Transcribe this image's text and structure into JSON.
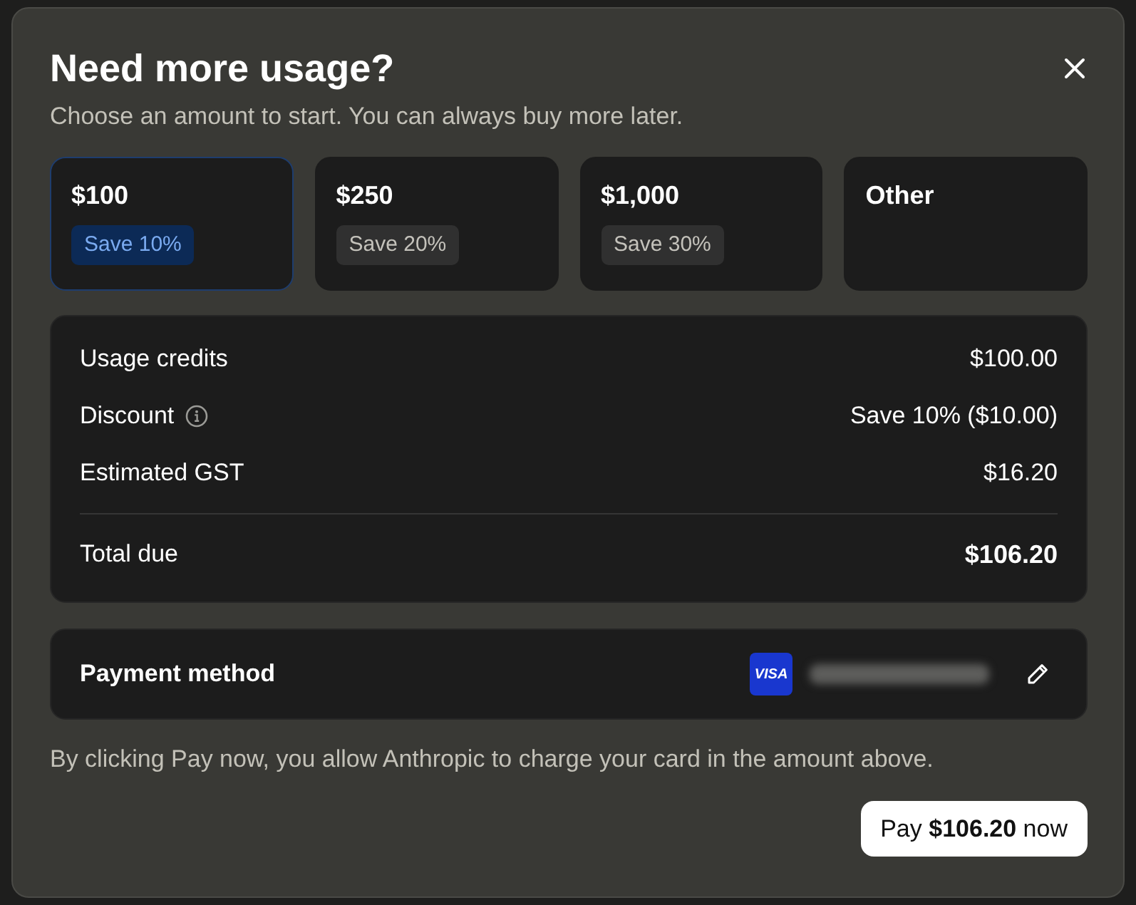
{
  "dialog": {
    "title": "Need more usage?",
    "subtitle": "Choose an amount to start. You can always buy more later."
  },
  "amount_options": [
    {
      "label": "$100",
      "badge": "Save 10%",
      "selected": true
    },
    {
      "label": "$250",
      "badge": "Save 20%",
      "selected": false
    },
    {
      "label": "$1,000",
      "badge": "Save 30%",
      "selected": false
    },
    {
      "label": "Other",
      "selected": false
    }
  ],
  "summary": {
    "rows": [
      {
        "kind": "plain",
        "label": "Usage credits",
        "value": "$100.00"
      },
      {
        "kind": "info",
        "label": "Discount",
        "value": "Save 10% ($10.00)"
      },
      {
        "kind": "plain",
        "label": "Estimated GST",
        "value": "$16.20"
      },
      {
        "kind": "total",
        "label": "Total due",
        "value": "$106.20"
      }
    ]
  },
  "payment": {
    "label": "Payment method",
    "card_brand": "VISA"
  },
  "disclaimer": "By clicking Pay now, you allow Anthropic to charge your card in the amount above.",
  "pay_button": "Pay **$106.20** now"
}
